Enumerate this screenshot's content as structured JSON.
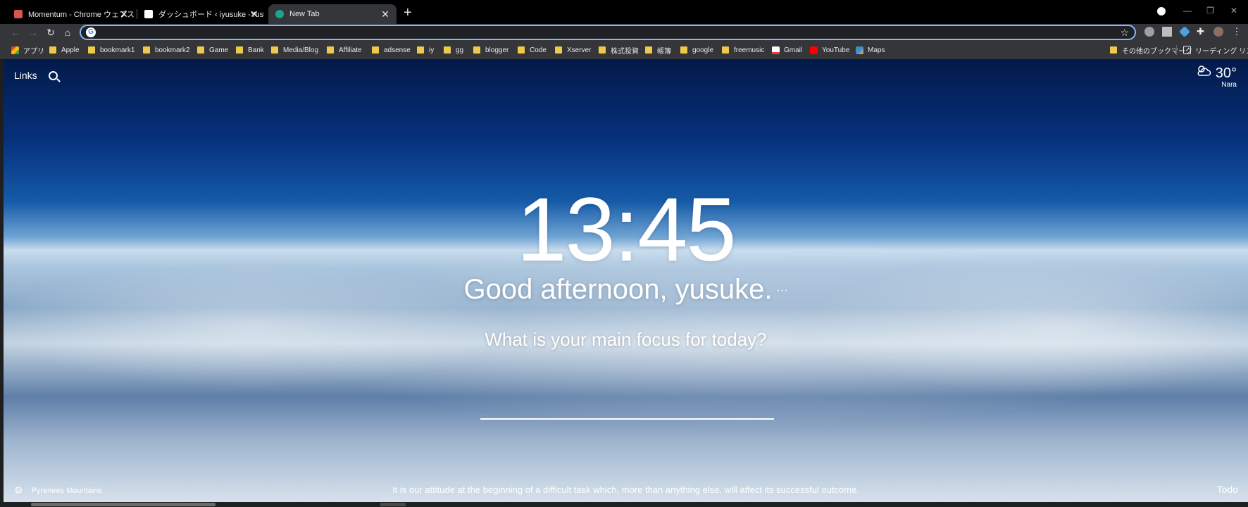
{
  "tabs": [
    {
      "title": "Momentum - Chrome ウェブストア",
      "active": false
    },
    {
      "title": "ダッシュボード ‹ iyusuke -YusukeMiyazaki",
      "active": false
    },
    {
      "title": "New Tab",
      "active": true
    }
  ],
  "toolbar": {
    "back_icon": "arrow-left-icon",
    "forward_icon": "arrow-right-icon",
    "reload_icon": "reload-icon",
    "home_icon": "home-icon",
    "omnibox_value": ""
  },
  "bookmarks": {
    "apps_label": "アプリ",
    "items": [
      "Apple",
      "bookmark1",
      "bookmark2",
      "Game",
      "Bank",
      "Media/Blog",
      "Affiliate",
      "adsense",
      "iy",
      "gg",
      "blogger",
      "Code",
      "Xserver",
      "株式投資",
      "帳簿",
      "google",
      "freemusic",
      "Gmail",
      "YouTube",
      "Maps"
    ],
    "other_label": "その他のブックマーク",
    "reading_label": "リーディング リスト"
  },
  "momentum": {
    "links_label": "Links",
    "temperature": "30°",
    "city": "Nara",
    "time": "13:45",
    "greeting": "Good afternoon, yusuke.",
    "more": "···",
    "focus_question": "What is your main focus for today?",
    "photo_location": "Pyrenees Mountains",
    "quote": "It is our attitude at the beginning of a difficult task which, more than anything else, will affect its successful outcome.",
    "todo_label": "Todo"
  },
  "colors": {
    "folder": "#f0c94c",
    "omnibox_focus": "#8ab4f8",
    "tab_active": "#35363a"
  }
}
